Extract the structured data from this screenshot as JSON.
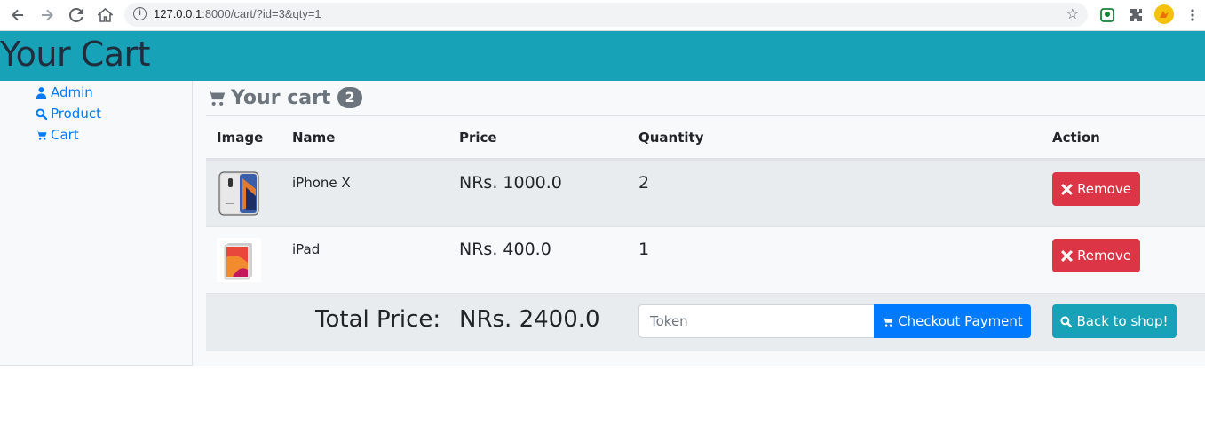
{
  "browser": {
    "url_host": "127.0.0.1",
    "url_rest": ":8000/cart/?id=3&qty=1"
  },
  "header": {
    "title": "Your Cart"
  },
  "sidebar": {
    "items": [
      {
        "label": "Admin",
        "icon": "user-icon"
      },
      {
        "label": "Product",
        "icon": "search-icon"
      },
      {
        "label": "Cart",
        "icon": "cart-icon"
      }
    ]
  },
  "main": {
    "title": "Your cart",
    "badge_count": "2",
    "columns": [
      "Image",
      "Name",
      "Price",
      "Quantity",
      "Action"
    ],
    "rows": [
      {
        "name": "iPhone X",
        "price": "NRs. 1000.0",
        "qty": "2",
        "action_label": "Remove",
        "image": "iphone-x"
      },
      {
        "name": "iPad",
        "price": "NRs. 400.0",
        "qty": "1",
        "action_label": "Remove",
        "image": "ipad"
      }
    ],
    "total_label": "Total Price:",
    "total_value": "NRs. 2400.0",
    "token_placeholder": "Token",
    "checkout_label": "Checkout Payment",
    "back_label": "Back to shop!"
  },
  "colors": {
    "header_bg": "#17a2b8",
    "primary": "#007bff",
    "danger": "#dc3545",
    "info": "#17a2b8",
    "muted": "#6c757d"
  }
}
